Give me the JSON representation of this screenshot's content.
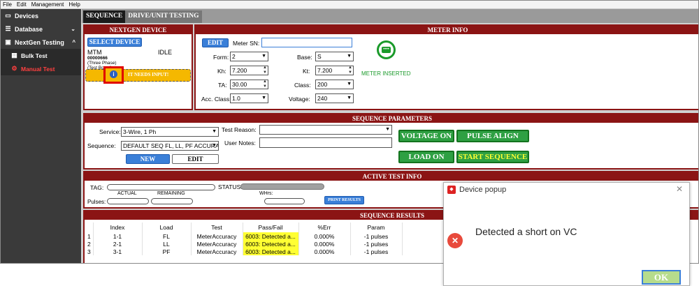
{
  "menubar": [
    "File",
    "Edit",
    "Management",
    "Help"
  ],
  "sidebar": {
    "items": [
      {
        "label": "Devices",
        "icon": "monitor-icon"
      },
      {
        "label": "Database",
        "icon": "database-icon",
        "chev": "⌄"
      },
      {
        "label": "NextGen Testing",
        "icon": "device-icon",
        "chev": "^"
      },
      {
        "label": "Bulk Test",
        "icon": "meters-icon"
      },
      {
        "label": "Manual Test",
        "icon": "manual-test-icon"
      }
    ]
  },
  "tabs": [
    "SEQUENCE",
    "DRIVE/UNIT TESTING"
  ],
  "nextgen": {
    "header": "NEXTGEN DEVICE",
    "select_label": "SELECT DEVICE",
    "name": "MTM",
    "status": "IDLE",
    "serial": "00000666",
    "line1": "(Three Phase)",
    "line2": "(Test Board)",
    "warning": "IT NEEDS INPUT!"
  },
  "meter": {
    "header": "METER INFO",
    "edit_label": "EDIT",
    "sn_label": "Meter SN:",
    "sn_value": "",
    "form_label": "Form:",
    "form_value": "2",
    "base_label": "Base:",
    "base_value": "S",
    "kh_label": "Kh:",
    "kh_value": "7.200",
    "kt_label": "Kt:",
    "kt_value": "7.200",
    "ta_label": "TA:",
    "ta_value": "30.00",
    "class_label": "Class:",
    "class_value": "200",
    "acc_label": "Acc. Class:",
    "acc_value": "1.0",
    "voltage_label": "Voltage:",
    "voltage_value": "240",
    "status_text": "METER INSERTED"
  },
  "sequence": {
    "header": "SEQUENCE PARAMETERS",
    "service_label": "Service:",
    "service_value": "3-Wire, 1 Ph",
    "reason_label": "Test Reason:",
    "reason_value": "",
    "notes_label": "User Notes:",
    "notes_value": "",
    "seq_label": "Sequence:",
    "seq_value": "DEFAULT SEQ FL, LL, PF ACCURA",
    "new_label": "NEW",
    "edit_label": "EDIT",
    "voltage_on": "VOLTAGE ON",
    "pulse_align": "PULSE ALIGN",
    "load_on": "LOAD ON",
    "start_sequence": "START SEQUENCE"
  },
  "active": {
    "header": "ACTIVE TEST INFO",
    "tag_label": "TAG:",
    "status_label": "STATUS:",
    "actual_label": "ACTUAL",
    "remaining_label": "REMAINING",
    "pulses_label": "Pulses:",
    "whrs_label": "WHrs:",
    "print_label": "PRINT RESULTS"
  },
  "results": {
    "header": "SEQUENCE RESULTS",
    "columns": [
      "Index",
      "Load",
      "Test",
      "Pass/Fail",
      "%Err",
      "Param"
    ],
    "rows": [
      {
        "n": "1",
        "index": "1-1",
        "load": "FL",
        "test": "MeterAccuracy",
        "pf": "6003: Detected a...",
        "err": "0.000%",
        "param": "-1 pulses"
      },
      {
        "n": "2",
        "index": "2-1",
        "load": "LL",
        "test": "MeterAccuracy",
        "pf": "6003: Detected a...",
        "err": "0.000%",
        "param": "-1 pulses"
      },
      {
        "n": "3",
        "index": "3-1",
        "load": "PF",
        "test": "MeterAccuracy",
        "pf": "6003: Detected a...",
        "err": "0.000%",
        "param": "-1 pulses"
      }
    ]
  },
  "popup": {
    "title": "Device popup",
    "message": "Detected a short on VC",
    "ok_label": "OK",
    "close": "✕"
  },
  "colors": {
    "accent_red": "#8b1414",
    "green": "#2ea043",
    "blue": "#3a7fd8",
    "warning_yellow": "#f5b800"
  }
}
